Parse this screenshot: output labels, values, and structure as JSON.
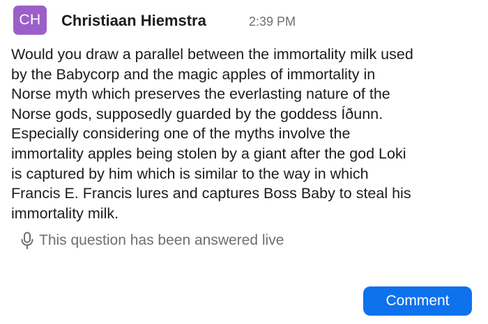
{
  "message": {
    "avatar": {
      "initials": "CH",
      "color": "#9c5fc9"
    },
    "author": "Christiaan Hiemstra",
    "time": "2:39 PM",
    "lines": [
      "Would you draw a parallel between the immortality milk used",
      "by the Babycorp and the magic apples of immortality in",
      "Norse myth which preserves the everlasting nature of the",
      "Norse gods, supposedly guarded by the goddess Íðunn.",
      "Especially considering one of the myths involve the",
      "immortality apples being stolen by a giant after the god Loki",
      "is captured by him which is similar to the way in which",
      "Francis E. Francis lures and captures Boss Baby to steal his",
      "immortality milk."
    ],
    "status": {
      "icon": "microphone-icon",
      "text": "This question has been answered live",
      "color": "#6e6e73"
    }
  },
  "actions": {
    "comment_label": "Comment",
    "accent_color": "#0e72ed"
  }
}
